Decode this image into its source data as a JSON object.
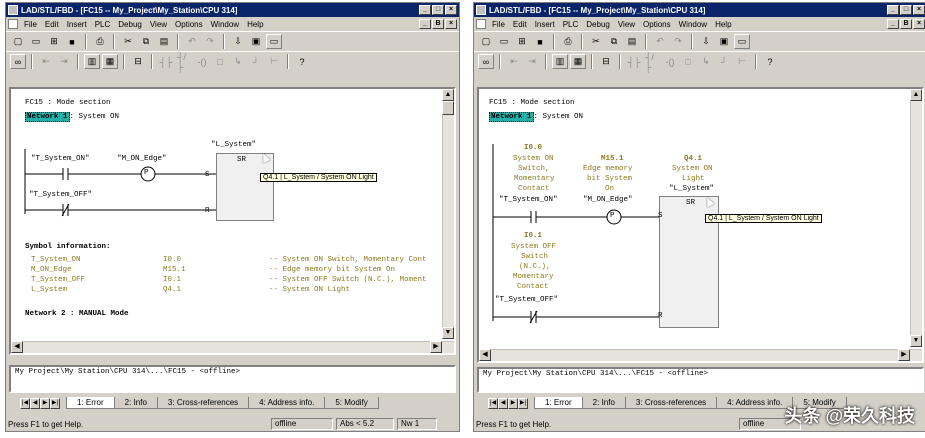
{
  "left": {
    "title": "LAD/STL/FBD - [FC15 -- My_Project\\My_Station\\CPU 314]",
    "window_buttons": [
      "_",
      "□",
      "×"
    ],
    "doc_buttons": [
      "_",
      "B",
      "×"
    ],
    "menu": [
      "File",
      "Edit",
      "Insert",
      "PLC",
      "Debug",
      "View",
      "Options",
      "Window",
      "Help"
    ],
    "section_title": "FC15 : Mode section",
    "network_tag": "Network 1",
    "network_title": ": System ON",
    "rung_label_1": "\"T_System_ON\"",
    "rung_label_2": "\"M_ON_Edge\"",
    "rung_label_3": "\"T_System_OFF\"",
    "box_name": "\"L_System\"",
    "box_type": "SR",
    "coil_p": "P",
    "pin_s": "S",
    "pin_r": "R",
    "tooltip": "Q4.1 | L_System / System ON Light",
    "symbol_header": "Symbol information:",
    "symbols": [
      {
        "name": "T_System_ON",
        "addr": "I0.0",
        "comment": "-- System ON Switch, Momentary Cont"
      },
      {
        "name": "M_ON_Edge",
        "addr": "M15.1",
        "comment": "-- Edge memory bit System On"
      },
      {
        "name": "T_System_OFF",
        "addr": "I0.1",
        "comment": "-- System OFF Switch (N.C.), Moment"
      },
      {
        "name": "L_System",
        "addr": "Q4.1",
        "comment": "-- System ON Light"
      }
    ],
    "network2": "Network 2 : MANUAL Mode",
    "output_path": "My Project\\My Station\\CPU 314\\...\\FC15 - <offline>",
    "tabs": [
      "1: Error",
      "2: Info",
      "3: Cross-references",
      "4: Address info.",
      "5: Modify"
    ],
    "status": {
      "help": "Press F1 to get Help.",
      "mode": "offline",
      "abs": "Abs < 5.2",
      "nw": "Nw 1"
    }
  },
  "right": {
    "title": "LAD/STL/FBD - [FC15 -- My_Project\\My_Station\\CPU 314]",
    "window_buttons": [
      "_",
      "□",
      "×"
    ],
    "doc_buttons": [
      "_",
      "B",
      "×"
    ],
    "menu": [
      "File",
      "Edit",
      "Insert",
      "PLC",
      "Debug",
      "View",
      "Options",
      "Window",
      "Help"
    ],
    "section_title": "FC15 : Mode section",
    "network_tag": "Network 1",
    "network_title": ": System ON",
    "contact1": {
      "addr": "I0.0",
      "lines": [
        "System ON",
        "Switch,",
        "Momentary",
        "Contact"
      ],
      "name": "\"T_System_ON\""
    },
    "edge": {
      "addr": "M15.1",
      "lines": [
        "Edge memory",
        "bit System",
        "On"
      ],
      "name": "\"M_ON_Edge\""
    },
    "output": {
      "addr": "Q4.1",
      "lines": [
        "System ON",
        "Light"
      ],
      "name": "\"L_System\""
    },
    "contact2": {
      "addr": "I0.1",
      "lines": [
        "System OFF",
        "Switch",
        "(N.C.),",
        "Momentary",
        "Contact"
      ],
      "name": "\"T_System_OFF\""
    },
    "box_type": "SR",
    "coil_p": "P",
    "pin_s": "S",
    "pin_r": "R",
    "tooltip": "Q4.1 | L_System / System ON Light",
    "output_path": "My Project\\My Station\\CPU 314\\...\\FC15 - <offline>",
    "tabs": [
      "1: Error",
      "2: Info",
      "3: Cross-references",
      "4: Address info.",
      "5: Modify"
    ],
    "status": {
      "help": "Press F1 to get Help.",
      "mode": "offline"
    }
  },
  "watermark": "头条 @荣久科技"
}
